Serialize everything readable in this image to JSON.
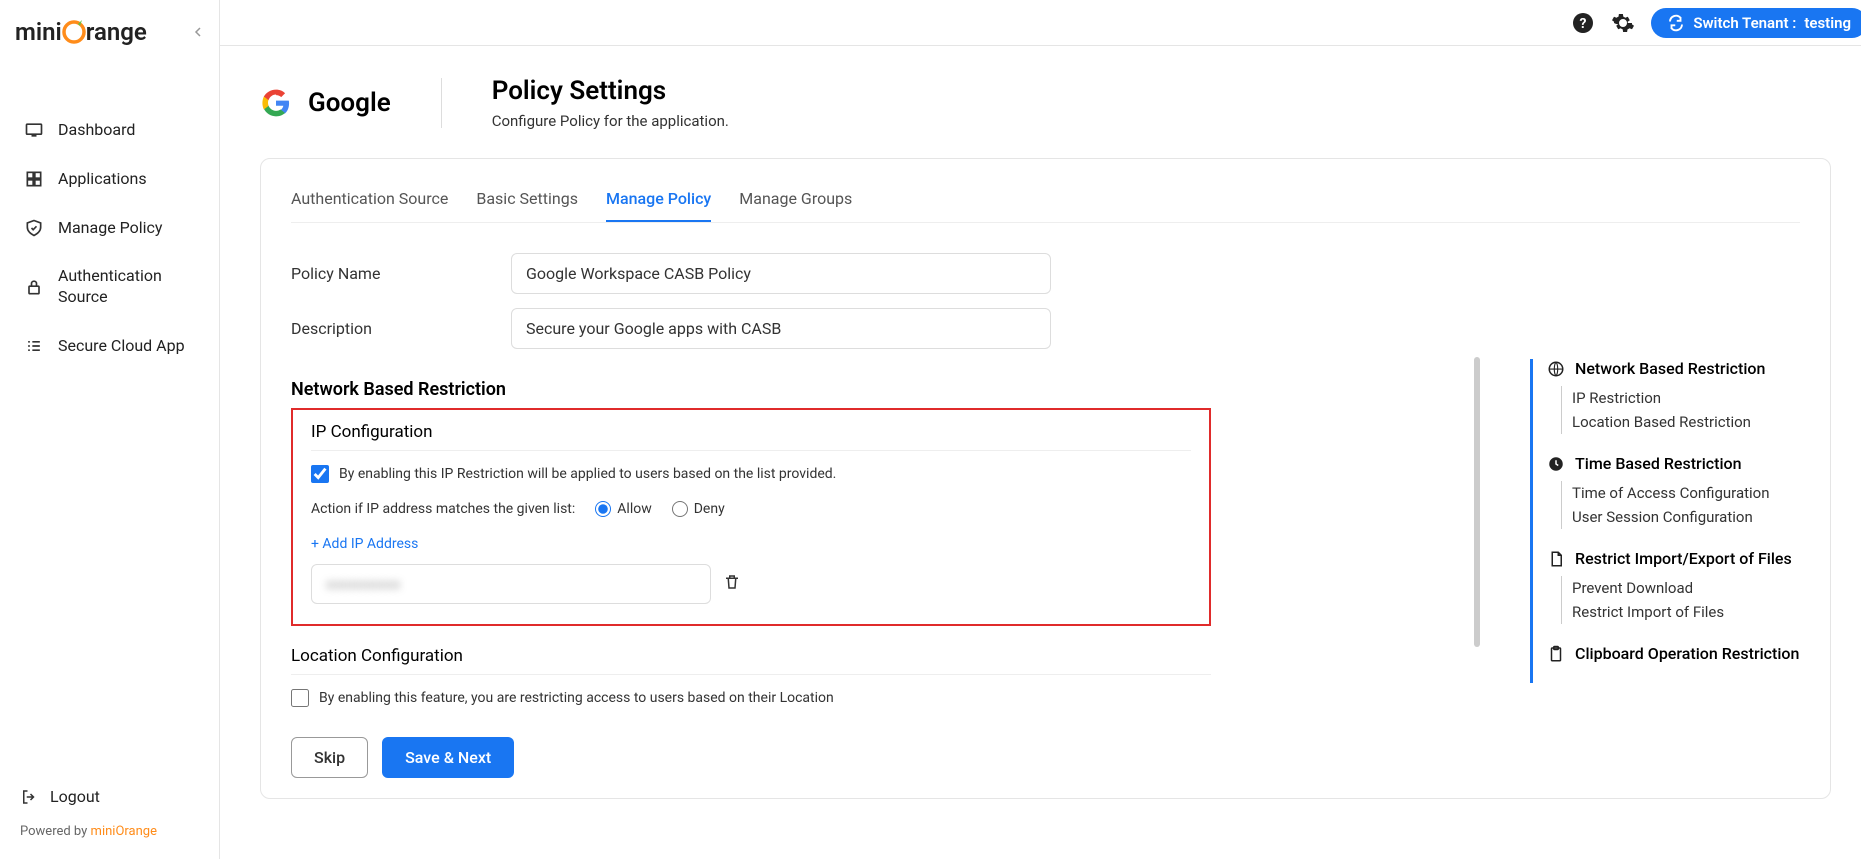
{
  "logo": {
    "part1": "mini",
    "part2": "range"
  },
  "sidebar": {
    "nav": [
      {
        "label": "Dashboard"
      },
      {
        "label": "Applications"
      },
      {
        "label": "Manage Policy"
      },
      {
        "label": "Authentication Source"
      },
      {
        "label": "Secure Cloud App"
      }
    ],
    "logout": "Logout",
    "powered_prefix": "Powered by ",
    "powered_brand": "miniOrange"
  },
  "topbar": {
    "switch_label": "Switch Tenant :",
    "tenant": "testing"
  },
  "header": {
    "app_name": "Google",
    "title": "Policy Settings",
    "subtitle": "Configure Policy for the application."
  },
  "tabs": [
    {
      "label": "Authentication Source"
    },
    {
      "label": "Basic Settings"
    },
    {
      "label": "Manage Policy",
      "active": true
    },
    {
      "label": "Manage Groups"
    }
  ],
  "form": {
    "policy_name_label": "Policy Name",
    "policy_name_value": "Google Workspace CASB Policy",
    "description_label": "Description",
    "description_value": "Secure your Google apps with CASB"
  },
  "network_section": {
    "title": "Network Based Restriction",
    "ip_config_title": "IP Configuration",
    "enable_text": "By enabling this IP Restriction will be applied to users based on the list provided.",
    "action_label": "Action if IP address matches the given list:",
    "allow": "Allow",
    "deny": "Deny",
    "add_ip": "+ Add IP Address",
    "ip_value": "xxxxxxxxxx",
    "location_title": "Location Configuration",
    "location_text": "By enabling this feature, you are restricting access to users based on their Location"
  },
  "buttons": {
    "skip": "Skip",
    "save": "Save & Next"
  },
  "right_panel": {
    "s1": {
      "head": "Network Based Restriction",
      "items": [
        "IP Restriction",
        "Location Based Restriction"
      ]
    },
    "s2": {
      "head": "Time Based Restriction",
      "items": [
        "Time of Access Configuration",
        "User Session Configuration"
      ]
    },
    "s3": {
      "head": "Restrict Import/Export of Files",
      "items": [
        "Prevent Download",
        "Restrict Import of Files"
      ]
    },
    "s4": {
      "head": "Clipboard Operation Restriction"
    }
  }
}
